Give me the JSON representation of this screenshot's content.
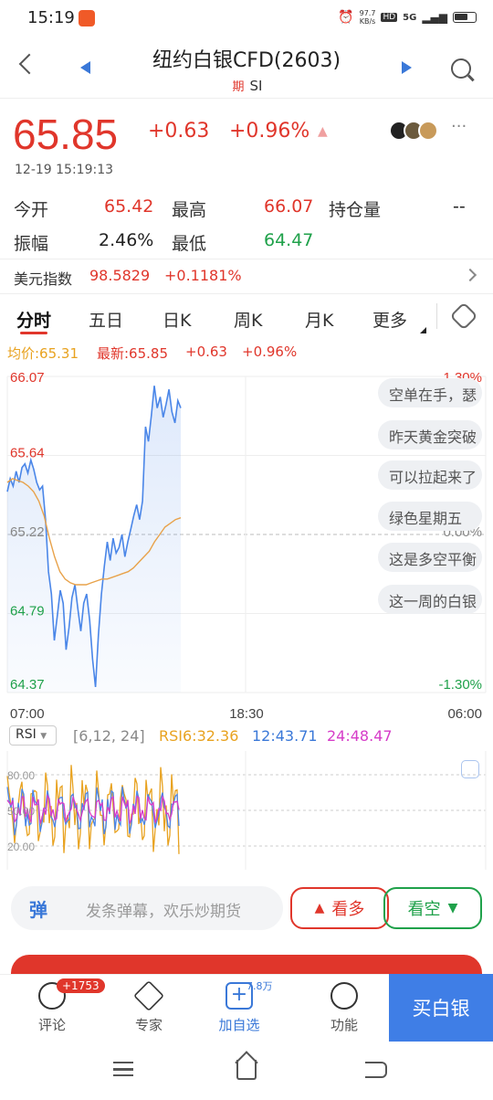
{
  "status": {
    "time": "15:19",
    "speed_top": "97.7",
    "speed_bottom": "KB/s",
    "hd": "HD",
    "net": "5G"
  },
  "header": {
    "title": "纽约白银CFD(2603)",
    "badge": "期",
    "symbol": "SI"
  },
  "quote": {
    "price": "65.85",
    "change": "+0.63",
    "change_pct": "+0.96%",
    "timestamp": "12-19  15:19:13"
  },
  "stats": {
    "open_label": "今开",
    "open_value": "65.42",
    "high_label": "最高",
    "high_value": "66.07",
    "oi_label": "持仓量",
    "oi_value": "--",
    "amp_label": "振幅",
    "amp_value": "2.46%",
    "low_label": "最低",
    "low_value": "64.47"
  },
  "usd_index": {
    "label": "美元指数",
    "value": "98.5829",
    "change": "+0.1181%"
  },
  "tabs": [
    "分时",
    "五日",
    "日K",
    "周K",
    "月K",
    "更多"
  ],
  "chart_header": {
    "avg": "均价:65.31",
    "latest": "最新:65.85",
    "change": "+0.63",
    "pct": "+0.96%"
  },
  "colors": {
    "red": "#e0362b",
    "green": "#1fa14a",
    "blue": "#3a78d8",
    "line": "#4a86e8",
    "avg": "#e8a24a",
    "rsi6": "#e8a21f",
    "rsi12": "#4a86e8",
    "rsi24": "#d63cc8",
    "buy": "#3f7ee6"
  },
  "chart_data": [
    {
      "type": "line",
      "title": "",
      "ylim": [
        64.37,
        66.07
      ],
      "y_ticks_left": [
        "66.07",
        "65.64",
        "65.22",
        "64.79",
        "64.37"
      ],
      "y_ticks_right": [
        "1.30%",
        "0.00%",
        "-1.30%"
      ],
      "x_ticks": [
        "07:00",
        "18:30",
        "06:00"
      ],
      "series": [
        {
          "values": [
            65.45,
            65.52,
            65.48,
            65.56,
            65.5,
            65.58,
            65.6,
            65.55,
            65.62,
            65.57,
            65.5,
            65.46,
            65.48,
            65.3,
            65.02,
            64.9,
            64.65,
            64.78,
            64.92,
            64.85,
            64.6,
            64.72,
            64.88,
            64.95,
            64.82,
            64.7,
            64.85,
            64.9,
            64.76,
            64.55,
            64.4,
            64.68,
            64.9,
            65.05,
            65.18,
            65.08,
            65.2,
            65.12,
            65.15,
            65.22,
            65.1,
            65.18,
            65.25,
            65.32,
            65.38,
            65.3,
            65.4,
            65.8,
            65.72,
            65.86,
            66.02,
            65.9,
            65.96,
            65.85,
            65.92,
            66.0,
            65.88,
            65.82,
            65.94,
            65.9
          ]
        },
        {
          "values": [
            65.5,
            65.52,
            65.51,
            65.5,
            65.48,
            65.45,
            65.4,
            65.32,
            65.2,
            65.1,
            65.02,
            64.98,
            64.96,
            64.95,
            64.95,
            64.95,
            64.96,
            64.97,
            64.98,
            64.98,
            64.99,
            65.0,
            65.01,
            65.02,
            65.04,
            65.07,
            65.1,
            65.13,
            65.18,
            65.22,
            65.26,
            65.28,
            65.3,
            65.31
          ]
        }
      ]
    },
    {
      "type": "line",
      "title": "",
      "ylim": [
        0,
        100
      ],
      "y_ticks": [
        "80.00",
        "50.00",
        "20.00"
      ],
      "params": "[6,12, 24]",
      "series": [
        {
          "name": "RSI6",
          "latest": "32.36"
        },
        {
          "name": "12",
          "latest": "43.71"
        },
        {
          "name": "24",
          "latest": "48.47"
        }
      ]
    }
  ],
  "rsi_label": "RSI",
  "danmu": [
    "空单在手，瑟",
    "昨天黄金突破",
    "可以拉起来了",
    "绿色星期五",
    "这是多空平衡",
    "这一周的白银"
  ],
  "input": {
    "icon_text": "弹",
    "placeholder": "发条弹幕，欢乐炒期货"
  },
  "actions": {
    "long": "看多",
    "short": "看空",
    "buy": "买白银"
  },
  "nav": [
    {
      "label": "评论",
      "badge": "+1753"
    },
    {
      "label": "专家"
    },
    {
      "label": "加自选",
      "badge": "7.8万"
    },
    {
      "label": "功能"
    }
  ]
}
